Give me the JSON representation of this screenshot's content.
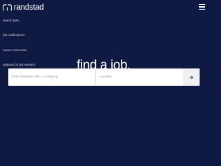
{
  "brand": {
    "name": "randstad"
  },
  "nav": {
    "items": [
      {
        "label": "search jobs"
      },
      {
        "label": "job notifications"
      },
      {
        "label": "career resources"
      },
      {
        "label": "salaries for job seekers"
      }
    ]
  },
  "hero": {
    "title": "find a job."
  },
  "search": {
    "keyword_placeholder": "Enter keyword, title or company",
    "location_placeholder": "Location"
  },
  "colors": {
    "background": "#0f1941",
    "text": "#ffffff",
    "button_bg": "#eff0f4"
  },
  "icons": {
    "logo": "randstad-logo-icon",
    "menu": "hamburger-menu-icon",
    "submit": "arrow-right-icon"
  }
}
